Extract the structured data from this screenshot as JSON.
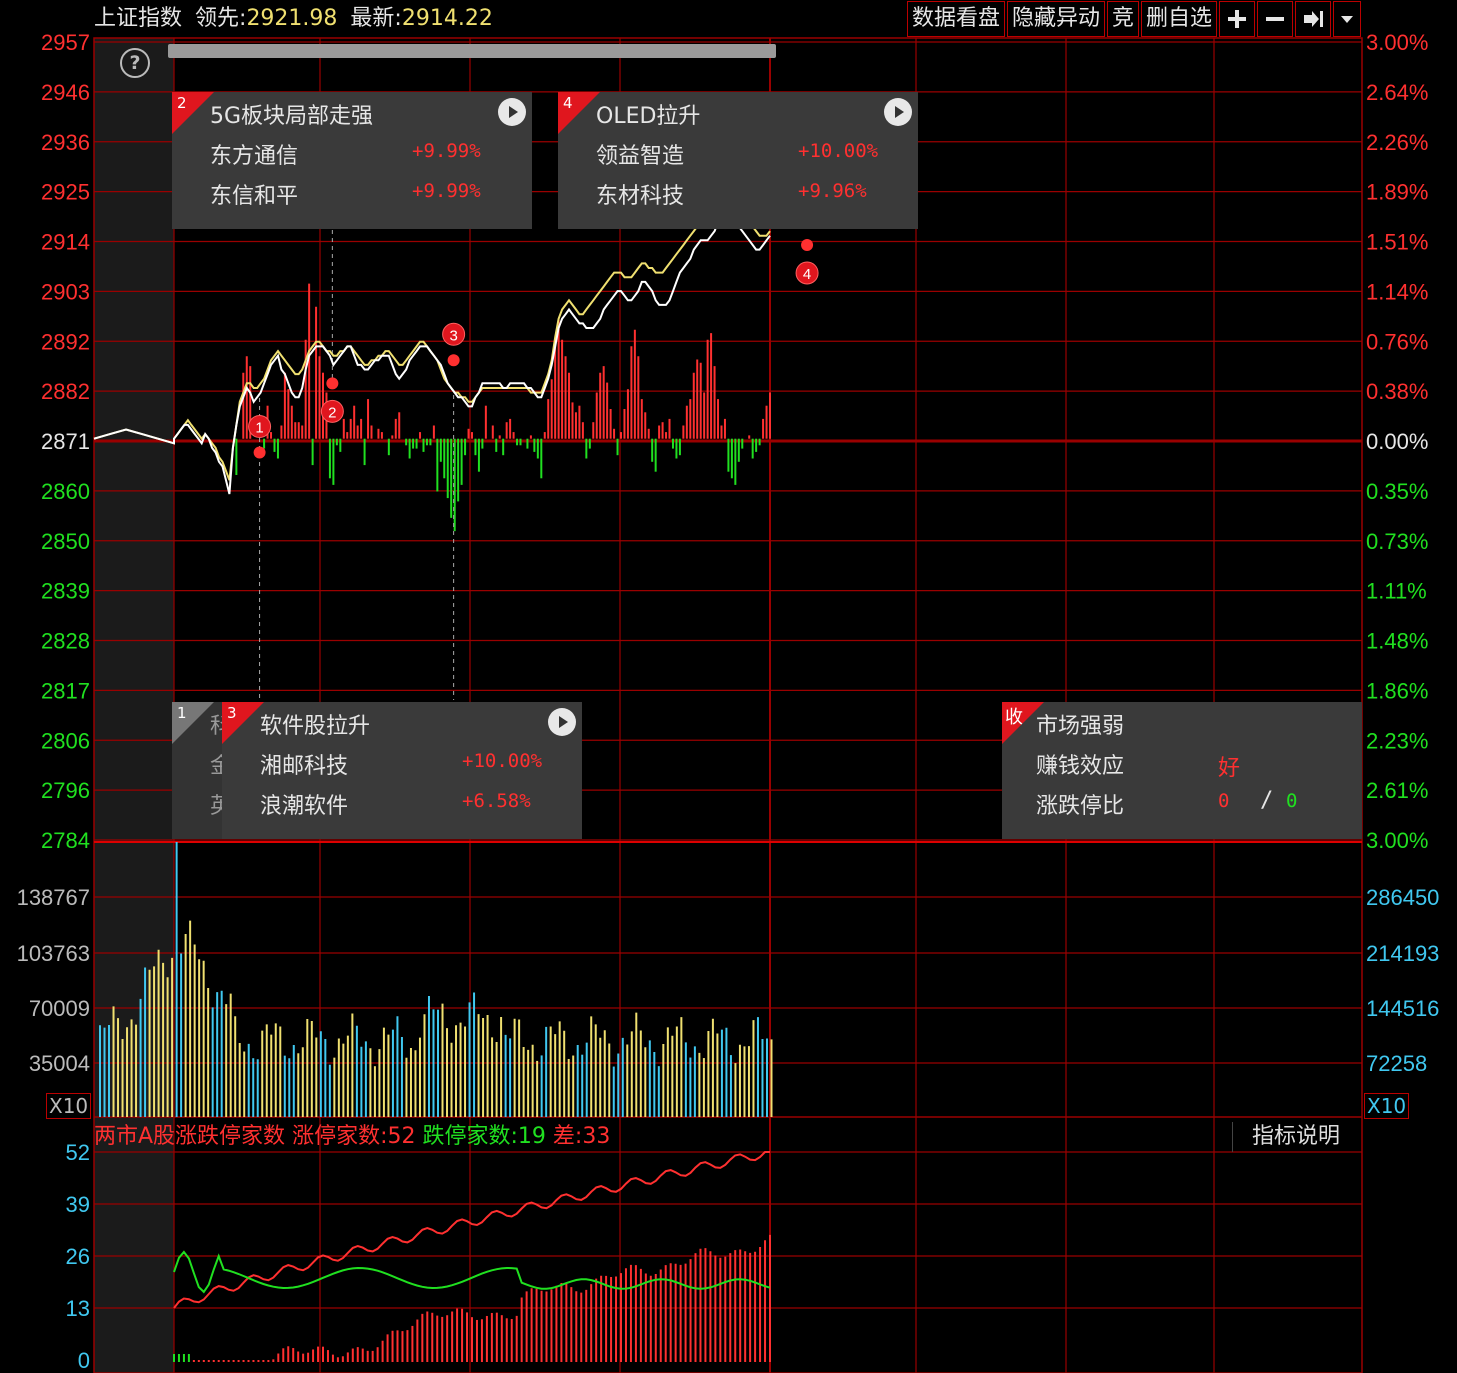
{
  "header": {
    "index_name": "上证指数",
    "lead_label": "领先:",
    "lead_value": "2921.98",
    "latest_label": "最新:",
    "latest_value": "2914.22"
  },
  "toolbar": {
    "data_view": "数据看盘",
    "hide_moves": "隐藏异动",
    "auction": "竞",
    "delete_watch": "删自选",
    "add_icon": "plus-icon",
    "remove_icon": "minus-icon",
    "export_icon": "arrow-right-bar-icon",
    "menu_icon": "caret-down-icon"
  },
  "help_icon": "?",
  "price_axis": {
    "left": [
      "2957",
      "2946",
      "2936",
      "2925",
      "2914",
      "2903",
      "2892",
      "2882",
      "2871",
      "2860",
      "2850",
      "2839",
      "2828",
      "2817",
      "2806",
      "2796",
      "2784"
    ],
    "right": [
      "3.00%",
      "2.64%",
      "2.26%",
      "1.89%",
      "1.51%",
      "1.14%",
      "0.76%",
      "0.38%",
      "0.00%",
      "0.35%",
      "0.73%",
      "1.11%",
      "1.48%",
      "1.86%",
      "2.23%",
      "2.61%",
      "3.00%"
    ]
  },
  "volume_axis": {
    "left": [
      "138767",
      "103763",
      "70009",
      "35004"
    ],
    "right": [
      "286450",
      "214193",
      "144516",
      "72258"
    ],
    "unit_left": "X10",
    "unit_right": "X10"
  },
  "indicator": {
    "title": "两市A股涨跌停家数",
    "up_label": "涨停家数:",
    "up_value": "52",
    "down_label": "跌停家数:",
    "down_value": "19",
    "diff_label": "差:",
    "diff_value": "33",
    "explain": "指标说明",
    "axis": [
      "52",
      "39",
      "26",
      "13",
      "0"
    ]
  },
  "cards": [
    {
      "num": "2",
      "title": "5G板块局部走强",
      "rows": [
        {
          "name": "东方通信",
          "pct": "+9.99%"
        },
        {
          "name": "东信和平",
          "pct": "+9.99%"
        }
      ]
    },
    {
      "num": "4",
      "title": "OLED拉升",
      "rows": [
        {
          "name": "领益智造",
          "pct": "+10.00%"
        },
        {
          "name": "东材科技",
          "pct": "+9.96%"
        }
      ]
    },
    {
      "num": "1",
      "title": "科",
      "rows": [
        {
          "name": "金"
        },
        {
          "name": "英"
        }
      ]
    },
    {
      "num": "3",
      "title": "软件股拉升",
      "rows": [
        {
          "name": "湘邮科技",
          "pct": "+10.00%"
        },
        {
          "name": "浪潮软件",
          "pct": "+6.58%"
        }
      ]
    },
    {
      "num": "收",
      "title": "市场强弱",
      "rows": [
        {
          "name": "赚钱效应",
          "val": "好"
        },
        {
          "name": "涨跌停比",
          "up": "0",
          "sep": "/",
          "down": "0"
        }
      ]
    }
  ],
  "markers": [
    "1",
    "2",
    "3",
    "4"
  ],
  "colors": {
    "up": "#ff3030",
    "down": "#20e020",
    "grid": "#9a0000",
    "index_line": "#ffffff",
    "lead_line": "#f0e070",
    "volume_up": "#f0e070",
    "volume_down": "#40c8f0",
    "axis_blue": "#40c8f0"
  },
  "chart_data": {
    "type": "line",
    "title": "上证指数",
    "prev_close": 2871,
    "y_range": [
      2784,
      2957
    ],
    "series": [
      {
        "name": "最新",
        "values": [
          2871,
          2872,
          2873,
          2874,
          2874,
          2873,
          2872,
          2871,
          2870,
          2872,
          2871,
          2869,
          2868,
          2866,
          2865,
          2862,
          2859,
          2869,
          2874,
          2878,
          2880,
          2882,
          2881,
          2879,
          2880,
          2881,
          2883,
          2885,
          2887,
          2888,
          2889,
          2886,
          2885,
          2883,
          2881,
          2880,
          2880,
          2882,
          2886,
          2889,
          2890,
          2891,
          2891,
          2891,
          2890,
          2889,
          2887,
          2888,
          2889,
          2890,
          2891,
          2891,
          2889,
          2887,
          2887,
          2886,
          2886,
          2887,
          2888,
          2888,
          2889,
          2889,
          2889,
          2887,
          2885,
          2884,
          2885,
          2886,
          2888,
          2889,
          2890,
          2891,
          2891,
          2891,
          2890,
          2889,
          2888,
          2887,
          2885,
          2883,
          2882,
          2881,
          2880,
          2880,
          2879,
          2878,
          2878,
          2880,
          2881,
          2883,
          2883,
          2883,
          2883,
          2883,
          2883,
          2882,
          2882,
          2883,
          2883,
          2883,
          2883,
          2883,
          2882,
          2882,
          2881,
          2880,
          2880,
          2882,
          2884,
          2887,
          2891,
          2895,
          2897,
          2898,
          2899,
          2898,
          2897,
          2896,
          2896,
          2895,
          2895,
          2895,
          2896,
          2897,
          2899,
          2900,
          2901,
          2902,
          2903,
          2903,
          2902,
          2901,
          2901,
          2902,
          2903,
          2905,
          2905,
          2904,
          2903,
          2901,
          2900,
          2900,
          2900,
          2901,
          2903,
          2905,
          2907,
          2908,
          2909,
          2910,
          2912,
          2913,
          2914,
          2914,
          2914,
          2915,
          2916,
          2918,
          2920,
          2921,
          2922,
          2921,
          2919,
          2917,
          2916,
          2915,
          2914,
          2913,
          2912,
          2912,
          2913,
          2914,
          2915
        ]
      },
      {
        "name": "领先",
        "values": [
          2871,
          2872,
          2873,
          2874,
          2875,
          2874,
          2873,
          2872,
          2871,
          2872,
          2871,
          2870,
          2869,
          2867,
          2866,
          2864,
          2862,
          2869,
          2874,
          2879,
          2881,
          2883,
          2883,
          2882,
          2882,
          2883,
          2884,
          2886,
          2888,
          2889,
          2890,
          2889,
          2888,
          2887,
          2886,
          2885,
          2885,
          2886,
          2888,
          2890,
          2891,
          2892,
          2892,
          2891,
          2890,
          2890,
          2889,
          2889,
          2890,
          2890,
          2891,
          2891,
          2890,
          2889,
          2888,
          2887,
          2887,
          2888,
          2888,
          2889,
          2889,
          2890,
          2890,
          2889,
          2888,
          2887,
          2887,
          2888,
          2889,
          2890,
          2891,
          2892,
          2892,
          2891,
          2890,
          2889,
          2888,
          2886,
          2884,
          2883,
          2882,
          2881,
          2881,
          2880,
          2880,
          2879,
          2879,
          2880,
          2881,
          2882,
          2882,
          2882,
          2882,
          2882,
          2882,
          2882,
          2882,
          2882,
          2882,
          2882,
          2882,
          2882,
          2882,
          2881,
          2881,
          2881,
          2881,
          2883,
          2885,
          2888,
          2893,
          2897,
          2899,
          2900,
          2901,
          2900,
          2899,
          2898,
          2898,
          2899,
          2900,
          2901,
          2902,
          2903,
          2904,
          2905,
          2906,
          2907,
          2907,
          2907,
          2906,
          2906,
          2906,
          2907,
          2908,
          2909,
          2909,
          2908,
          2908,
          2907,
          2907,
          2907,
          2908,
          2909,
          2910,
          2911,
          2912,
          2913,
          2914,
          2915,
          2916,
          2917,
          2918,
          2919,
          2920,
          2921,
          2922,
          2923,
          2924,
          2924,
          2924,
          2923,
          2922,
          2921,
          2920,
          2919,
          2918,
          2917,
          2916,
          2915,
          2915,
          2915,
          2916
        ]
      }
    ],
    "macd_bars": [
      0,
      0,
      0,
      0,
      0,
      0,
      0,
      0,
      0,
      0,
      0,
      0,
      0,
      0,
      0,
      0,
      0,
      0,
      -11,
      0,
      20,
      25,
      22,
      0,
      0,
      0,
      -3,
      10,
      2,
      -4,
      -6,
      4,
      20,
      15,
      10,
      5,
      5,
      4,
      30,
      47,
      -8,
      40,
      25,
      20,
      14,
      -12,
      -14,
      -2,
      -4,
      6,
      2,
      6,
      10,
      4,
      6,
      -8,
      12,
      4,
      0,
      3,
      2,
      0,
      -5,
      1,
      6,
      8,
      0,
      -2,
      -6,
      -3,
      -3,
      2,
      -4,
      -2,
      -2,
      4,
      -16,
      -7,
      -12,
      -18,
      -24,
      -28,
      -19,
      -14,
      -5,
      3,
      2,
      -5,
      -10,
      -3,
      10,
      0,
      4,
      -4,
      1,
      -5,
      5,
      6,
      2,
      -2,
      -2,
      0,
      -3,
      1,
      -4,
      -6,
      -12,
      2,
      12,
      18,
      30,
      36,
      30,
      25,
      20,
      11,
      8,
      10,
      5,
      -6,
      -3,
      5,
      14,
      20,
      22,
      17,
      9,
      3,
      -5,
      2,
      9,
      15,
      28,
      33,
      25,
      12,
      8,
      3,
      -7,
      -10,
      4,
      5,
      2,
      6,
      -3,
      -6,
      -5,
      4,
      10,
      12,
      20,
      24,
      23,
      14,
      30,
      32,
      22,
      12,
      4,
      6,
      -10,
      -12,
      -14,
      -7,
      -3,
      0,
      1,
      -6,
      -4,
      -2,
      6,
      10,
      14
    ]
  }
}
